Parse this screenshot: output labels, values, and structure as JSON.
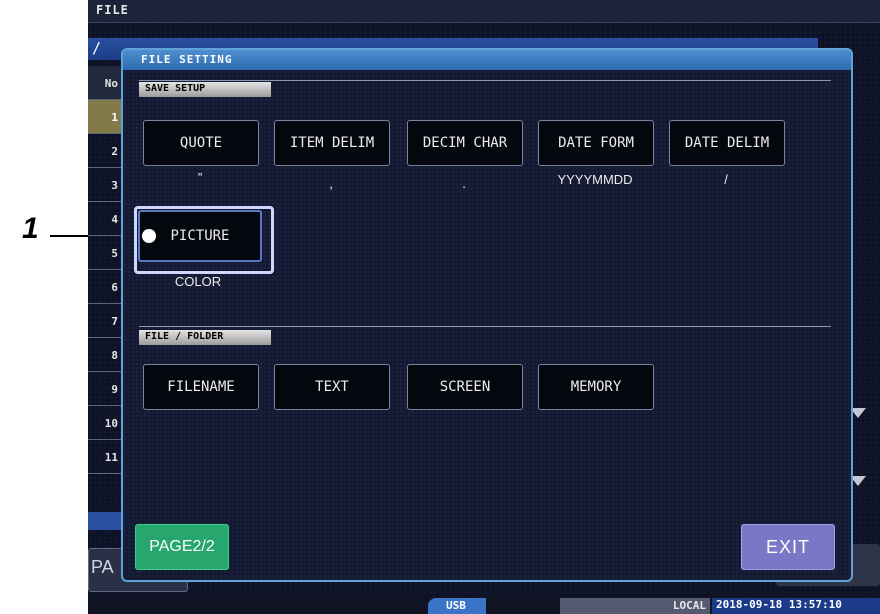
{
  "callout": {
    "number": "1"
  },
  "window": {
    "title": "FILE",
    "path": "/"
  },
  "file_table": {
    "header": "No",
    "rows": [
      "1",
      "2",
      "3",
      "4",
      "5",
      "6",
      "7",
      "8",
      "9",
      "10",
      "11"
    ],
    "selected": "1"
  },
  "left_bottom_button": "PA",
  "status": {
    "usb": "USB",
    "local": "LOCAL",
    "datetime": "2018-09-18 13:57:10"
  },
  "dialog": {
    "title": "FILE SETTING",
    "save_setup": {
      "label": "SAVE SETUP",
      "buttons": [
        {
          "label": "QUOTE",
          "value": "”"
        },
        {
          "label": "ITEM DELIM",
          "value": ","
        },
        {
          "label": "DECIM CHAR",
          "value": "."
        },
        {
          "label": "DATE FORM",
          "value": "YYYYMMDD"
        },
        {
          "label": "DATE DELIM",
          "value": "/"
        }
      ],
      "picture": {
        "label": "PICTURE",
        "value": "COLOR"
      }
    },
    "file_folder": {
      "label": "FILE / FOLDER",
      "buttons": [
        "FILENAME",
        "TEXT",
        "SCREEN",
        "MEMORY"
      ]
    },
    "page_button": "PAGE2/2",
    "exit_button": "EXIT"
  }
}
